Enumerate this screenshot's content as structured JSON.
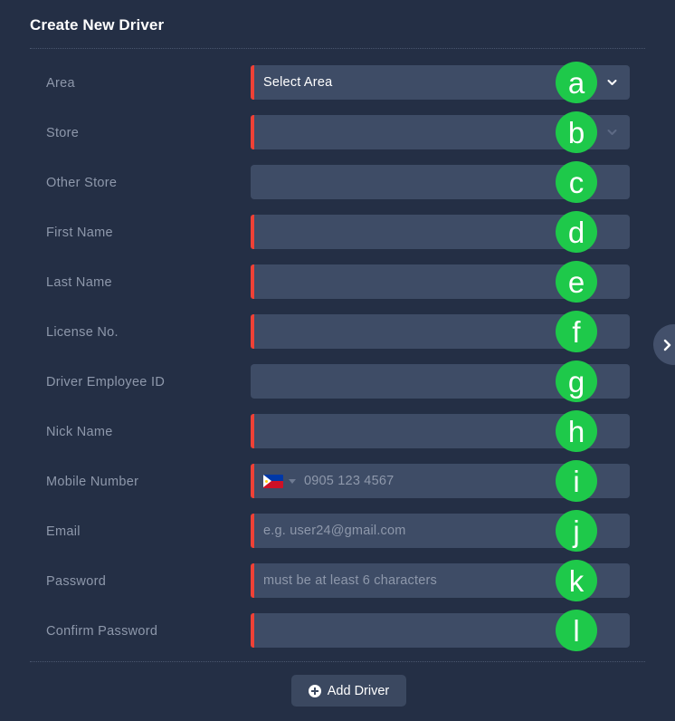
{
  "panel": {
    "title": "Create New Driver"
  },
  "form": {
    "rows": [
      {
        "label": "Area",
        "type": "select",
        "value": "Select Area",
        "placeholder": "",
        "required": true,
        "chevron": "bright",
        "marker": "a"
      },
      {
        "label": "Store",
        "type": "select",
        "value": "",
        "placeholder": "",
        "required": true,
        "chevron": "dim",
        "marker": "b"
      },
      {
        "label": "Other Store",
        "type": "text",
        "value": "",
        "placeholder": "",
        "required": false,
        "chevron": "",
        "marker": "c"
      },
      {
        "label": "First Name",
        "type": "text",
        "value": "",
        "placeholder": "",
        "required": true,
        "chevron": "",
        "marker": "d"
      },
      {
        "label": "Last Name",
        "type": "text",
        "value": "",
        "placeholder": "",
        "required": true,
        "chevron": "",
        "marker": "e"
      },
      {
        "label": "License No.",
        "type": "text",
        "value": "",
        "placeholder": "",
        "required": true,
        "chevron": "",
        "marker": "f"
      },
      {
        "label": "Driver Employee ID",
        "type": "text",
        "value": "",
        "placeholder": "",
        "required": false,
        "chevron": "",
        "marker": "g"
      },
      {
        "label": "Nick Name",
        "type": "text",
        "value": "",
        "placeholder": "",
        "required": true,
        "chevron": "",
        "marker": "h"
      },
      {
        "label": "Mobile Number",
        "type": "phone",
        "value": "",
        "placeholder": "0905 123 4567",
        "required": true,
        "chevron": "",
        "marker": "i",
        "flag": "philippines-flag-icon"
      },
      {
        "label": "Email",
        "type": "email",
        "value": "",
        "placeholder": "e.g. user24@gmail.com",
        "required": true,
        "chevron": "",
        "marker": "j"
      },
      {
        "label": "Password",
        "type": "password",
        "value": "",
        "placeholder": "must be at least 6 characters",
        "required": true,
        "chevron": "",
        "marker": "k"
      },
      {
        "label": "Confirm Password",
        "type": "password",
        "value": "",
        "placeholder": "",
        "required": true,
        "chevron": "",
        "marker": "l"
      }
    ]
  },
  "footer": {
    "submit_label": "Add Driver",
    "submit_icon": "plus-circle-icon"
  },
  "side_toggle": {
    "icon": "chevron-right-icon"
  },
  "colors": {
    "page_background": "#242f45",
    "field_background": "#3e4c66",
    "required_bar": "#ef4136",
    "label_text": "#8e98ab",
    "value_text": "#ffffff",
    "marker_green": "#1ec94a",
    "button_background": "#3b4860"
  }
}
